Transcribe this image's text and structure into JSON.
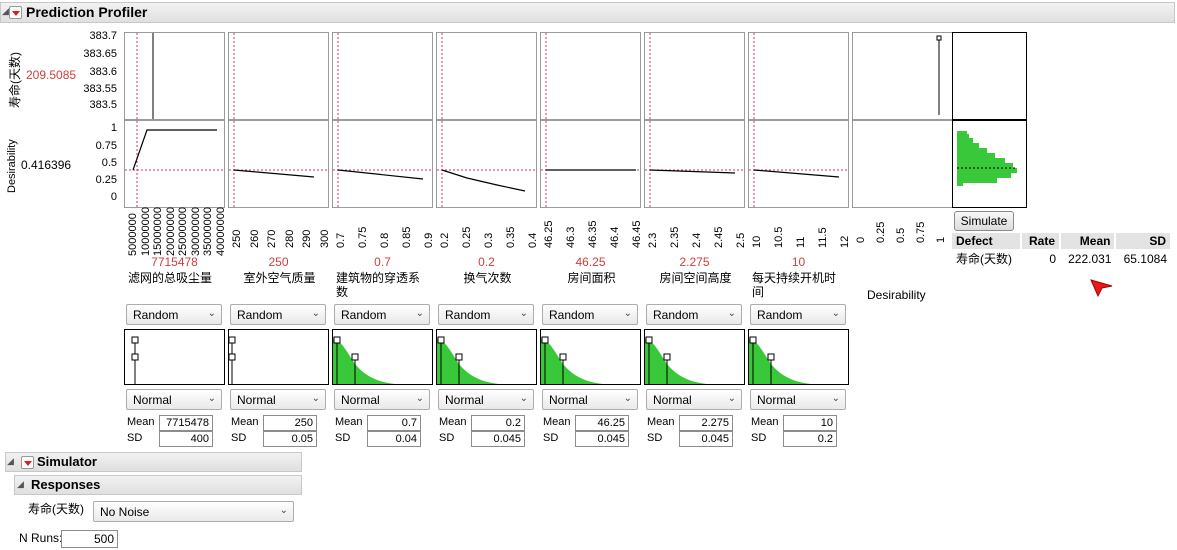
{
  "profiler": {
    "title": "Prediction Profiler",
    "response_name": "寿命(天数)",
    "response_value": "209.5085",
    "response_ticks": [
      "383.7",
      "383.65",
      "383.6",
      "383.55",
      "383.5"
    ],
    "desirability_label": "Desirability",
    "desirability_value": "0.416396",
    "desirability_ticks": [
      "1",
      "0.75",
      "0.5",
      "0.25",
      "0"
    ],
    "desirability_column_label": "Desirability",
    "desirability_x_ticks": [
      "0",
      "0.25",
      "0.5",
      "0.75",
      "1"
    ]
  },
  "factors": [
    {
      "name": "滤网的总吸尘量",
      "current": "7715478",
      "ticks": [
        "5000000",
        "10000000",
        "15000000",
        "20000000",
        "25000000",
        "30000000",
        "35000000",
        "40000000"
      ],
      "random": "Random",
      "dist": "Normal",
      "mean": "7715478",
      "sd": "400"
    },
    {
      "name": "室外空气质量",
      "current": "250",
      "ticks": [
        "250",
        "260",
        "270",
        "280",
        "290",
        "300"
      ],
      "random": "Random",
      "dist": "Normal",
      "mean": "250",
      "sd": "0.05"
    },
    {
      "name": "建筑物的穿透系数",
      "current": "0.7",
      "ticks": [
        "0.7",
        "0.75",
        "0.8",
        "0.85",
        "0.9"
      ],
      "random": "Random",
      "dist": "Normal",
      "mean": "0.7",
      "sd": "0.04"
    },
    {
      "name": "换气次数",
      "current": "0.2",
      "ticks": [
        "0.2",
        "0.25",
        "0.3",
        "0.35",
        "0.4"
      ],
      "random": "Random",
      "dist": "Normal",
      "mean": "0.2",
      "sd": "0.045"
    },
    {
      "name": "房间面积",
      "current": "46.25",
      "ticks": [
        "46.25",
        "46.3",
        "46.35",
        "46.4",
        "46.45"
      ],
      "random": "Random",
      "dist": "Normal",
      "mean": "46.25",
      "sd": "0.045"
    },
    {
      "name": "房间空间高度",
      "current": "2.275",
      "ticks": [
        "2.3",
        "2.35",
        "2.4",
        "2.45",
        "2.5"
      ],
      "random": "Random",
      "dist": "Normal",
      "mean": "2.275",
      "sd": "0.045"
    },
    {
      "name": "每天持续开机时间",
      "current": "10",
      "ticks": [
        "10",
        "10.5",
        "11",
        "11.5",
        "12"
      ],
      "random": "Random",
      "dist": "Normal",
      "mean": "10",
      "sd": "0.2"
    }
  ],
  "labels": {
    "mean": "Mean",
    "sd": "SD"
  },
  "simulate_button": "Simulate",
  "defect_table": {
    "headers": [
      "Defect",
      "Rate",
      "Mean",
      "SD"
    ],
    "row": [
      "寿命(天数)",
      "0",
      "222.031",
      "65.1084"
    ]
  },
  "simulator": {
    "title": "Simulator",
    "responses_title": "Responses",
    "response_name": "寿命(天数)",
    "noise_option": "No Noise",
    "nruns_label": "N Runs:",
    "nruns_value": "500"
  },
  "colors": {
    "accent_red": "#d23c3c",
    "green": "#39c83a",
    "dash": "#d0306a"
  }
}
